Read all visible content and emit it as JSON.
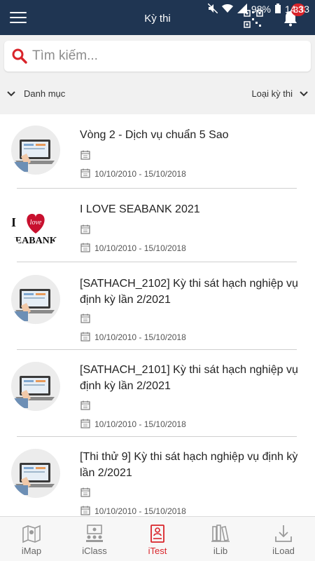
{
  "status": {
    "battery": "98%",
    "time": "14:33"
  },
  "header": {
    "title": "Kỳ thi",
    "notification_count": "33"
  },
  "search": {
    "placeholder": "Tìm kiếm..."
  },
  "filters": {
    "left_label": "Danh mục",
    "right_label": "Loại kỳ thi"
  },
  "exams": [
    {
      "name": "Vòng 2 - Dịch vụ chuẩn 5 Sao",
      "dates": "10/10/2010 - 15/10/2018",
      "thumb": "laptop-image"
    },
    {
      "name": " I LOVE SEABANK 2021",
      "dates": "10/10/2010 - 15/10/2018",
      "thumb": "i-love-seabank-logo"
    },
    {
      "name": "[SATHACH_2102] Kỳ thi sát hạch nghiệp vụ định kỳ lần 2/2021",
      "dates": "10/10/2010 - 15/10/2018",
      "thumb": "laptop-image"
    },
    {
      "name": "[SATHACH_2101] Kỳ thi sát hạch nghiệp vụ định kỳ lần 2/2021",
      "dates": "10/10/2010 - 15/10/2018",
      "thumb": "laptop-image"
    },
    {
      "name": "[Thi thử 9] Kỳ thi sát hạch nghiệp vụ định kỳ lần 2/2021",
      "dates": "10/10/2010 - 15/10/2018",
      "thumb": "laptop-image"
    }
  ],
  "logo_text": {
    "line1": "I",
    "heart": "love",
    "line2": "SEABANK"
  },
  "nav": [
    {
      "label": "iMap",
      "icon": "map-icon"
    },
    {
      "label": "iClass",
      "icon": "classroom-icon"
    },
    {
      "label": "iTest",
      "icon": "test-icon",
      "active": true
    },
    {
      "label": "iLib",
      "icon": "books-icon"
    },
    {
      "label": "iLoad",
      "icon": "download-icon"
    }
  ],
  "colors": {
    "header": "#1f3552",
    "accent": "#d9242a",
    "search_bg": "#f1f1f1"
  }
}
